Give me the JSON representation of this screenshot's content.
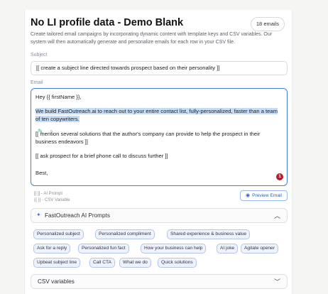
{
  "header": {
    "title": "No LI profile data - Demo Blank",
    "emails_badge": "18 emails"
  },
  "description": "Create tailored email campaigns by incorporating dynamic content with template keys and CSV variables. Our system will then automatically generate and personalize emails for each row in your CSV file.",
  "subject": {
    "label": "Subject",
    "value": "[[ create a subject line directed towards prospect based on their personality ]]"
  },
  "email": {
    "label": "Email",
    "greeting": "Hey {{ firstName }},",
    "highlighted_line1": "We build FastOutreach.ai to reach out to your entire contact list, fully-personalized, faster than a team",
    "highlighted_line2": "of ten copywriters.",
    "prompt1_line1": "[[ mention several solutions that the author's company can provide to help the prospect in their",
    "prompt1_line2": "business endeavors ]]",
    "prompt2": "[[ ask prospect for a brief phone call to discuss further ]]",
    "signoff": "Best,",
    "error_count": "1"
  },
  "legend": {
    "ai_prompt": "[[ ]] - AI Prompt",
    "csv_variable": "{{ }} - CSV Variable"
  },
  "preview_button": "Preview Email",
  "ai_prompts_section": {
    "title": "FastOutreach AI Prompts",
    "chips": [
      "Personalized subject",
      "Personalized compliment",
      "Shared experience & business value",
      "Ask for a reply",
      "Personalized fun fact",
      "How your business can help",
      "AI joke",
      "Agitate opener",
      "Upbeat subject line",
      "Call CTA",
      "What we do",
      "Quick solutions"
    ]
  },
  "csv_section": {
    "title": "CSV variables"
  },
  "colors": {
    "accent": "#4b7bd8",
    "highlight": "#c6dbf6",
    "error": "#b21e2e",
    "chip_bg": "#eef2fc"
  }
}
